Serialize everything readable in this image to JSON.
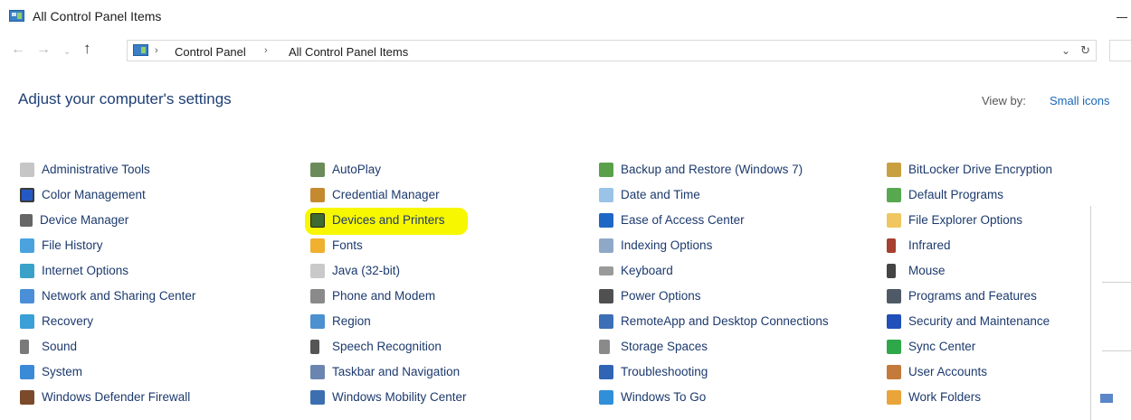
{
  "window": {
    "title": "All Control Panel Items"
  },
  "navbar": {
    "back_icon": "←",
    "forward_icon": "→",
    "recent_icon": "⌄",
    "up_icon": "↑",
    "breadcrumb": [
      "Control Panel",
      "All Control Panel Items"
    ],
    "separator": "›",
    "dropdown_icon": "⌄",
    "refresh_icon": "↻"
  },
  "header": {
    "title": "Adjust your computer's settings",
    "view_by_label": "View by:",
    "view_by_value": "Small icons"
  },
  "columns": [
    [
      {
        "label": "Administrative Tools",
        "icon": "admin-tools-icon"
      },
      {
        "label": "Color Management",
        "icon": "color-management-icon"
      },
      {
        "label": "Device Manager",
        "icon": "device-manager-icon"
      },
      {
        "label": "File History",
        "icon": "file-history-icon"
      },
      {
        "label": "Internet Options",
        "icon": "internet-options-icon"
      },
      {
        "label": "Network and Sharing Center",
        "icon": "network-icon"
      },
      {
        "label": "Recovery",
        "icon": "recovery-icon"
      },
      {
        "label": "Sound",
        "icon": "sound-icon"
      },
      {
        "label": "System",
        "icon": "system-icon"
      },
      {
        "label": "Windows Defender Firewall",
        "icon": "firewall-icon"
      }
    ],
    [
      {
        "label": "AutoPlay",
        "icon": "autoplay-icon"
      },
      {
        "label": "Credential Manager",
        "icon": "credential-manager-icon"
      },
      {
        "label": "Devices and Printers",
        "icon": "devices-printers-icon",
        "highlighted": true
      },
      {
        "label": "Fonts",
        "icon": "fonts-icon"
      },
      {
        "label": "Java (32-bit)",
        "icon": "java-icon"
      },
      {
        "label": "Phone and Modem",
        "icon": "phone-modem-icon"
      },
      {
        "label": "Region",
        "icon": "region-icon"
      },
      {
        "label": "Speech Recognition",
        "icon": "speech-recognition-icon"
      },
      {
        "label": "Taskbar and Navigation",
        "icon": "taskbar-icon"
      },
      {
        "label": "Windows Mobility Center",
        "icon": "mobility-center-icon"
      }
    ],
    [
      {
        "label": "Backup and Restore (Windows 7)",
        "icon": "backup-restore-icon"
      },
      {
        "label": "Date and Time",
        "icon": "date-time-icon"
      },
      {
        "label": "Ease of Access Center",
        "icon": "ease-of-access-icon"
      },
      {
        "label": "Indexing Options",
        "icon": "indexing-options-icon"
      },
      {
        "label": "Keyboard",
        "icon": "keyboard-icon"
      },
      {
        "label": "Power Options",
        "icon": "power-options-icon"
      },
      {
        "label": "RemoteApp and Desktop Connections",
        "icon": "remoteapp-icon"
      },
      {
        "label": "Storage Spaces",
        "icon": "storage-spaces-icon"
      },
      {
        "label": "Troubleshooting",
        "icon": "troubleshooting-icon"
      },
      {
        "label": "Windows To Go",
        "icon": "windows-to-go-icon"
      }
    ],
    [
      {
        "label": "BitLocker Drive Encryption",
        "icon": "bitlocker-icon"
      },
      {
        "label": "Default Programs",
        "icon": "default-programs-icon"
      },
      {
        "label": "File Explorer Options",
        "icon": "file-explorer-options-icon"
      },
      {
        "label": "Infrared",
        "icon": "infrared-icon"
      },
      {
        "label": "Mouse",
        "icon": "mouse-icon"
      },
      {
        "label": "Programs and Features",
        "icon": "programs-features-icon"
      },
      {
        "label": "Security and Maintenance",
        "icon": "security-maintenance-icon"
      },
      {
        "label": "Sync Center",
        "icon": "sync-center-icon"
      },
      {
        "label": "User Accounts",
        "icon": "user-accounts-icon"
      },
      {
        "label": "Work Folders",
        "icon": "work-folders-icon"
      }
    ]
  ],
  "colors": {
    "link": "#1c3a6e",
    "title": "#1e3f75",
    "highlight": "#f7f700",
    "view_by_value": "#1a67b8"
  }
}
